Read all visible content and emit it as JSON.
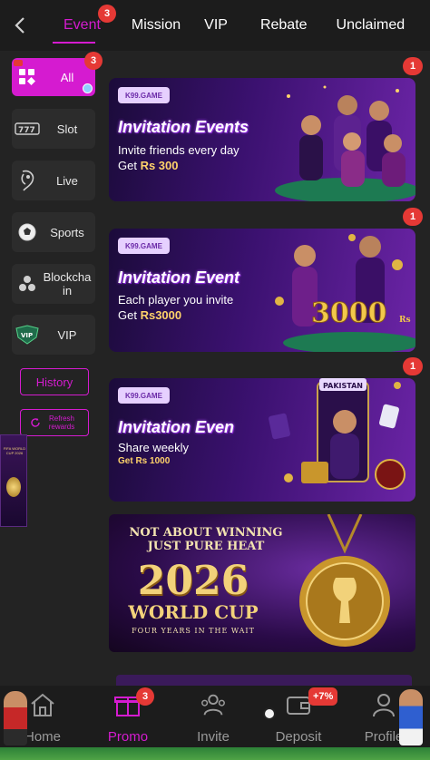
{
  "header": {
    "tabs": [
      {
        "label": "Event",
        "badge": "3"
      },
      {
        "label": "Mission"
      },
      {
        "label": "VIP"
      },
      {
        "label": "Rebate"
      },
      {
        "label": "Unclaimed"
      }
    ]
  },
  "sidebar": {
    "items": [
      {
        "label": "All",
        "badge": "3",
        "icon": "grid-icon"
      },
      {
        "label": "Slot",
        "icon": "slot-icon"
      },
      {
        "label": "Live",
        "icon": "live-icon"
      },
      {
        "label": "Sports",
        "icon": "soccer-ball-icon"
      },
      {
        "label": "Blockchain",
        "icon": "blockchain-icon"
      },
      {
        "label": "VIP",
        "icon": "vip-icon"
      }
    ],
    "history_label": "History",
    "refresh_label": "Refresh rewards"
  },
  "banners": [
    {
      "brand": "K99.GAME",
      "title": "Invitation Events",
      "line1": "Invite friends every day",
      "line2_prefix": "Get ",
      "line2_value": "Rs 300",
      "notif": "1"
    },
    {
      "brand": "K99.GAME",
      "title": "Invitation Event",
      "line1": "Each player you invite",
      "line2_prefix": "Get ",
      "line2_value": "Rs3000",
      "art_text": "3000",
      "art_unit": "Rs",
      "notif": "1"
    },
    {
      "brand": "K99.GAME",
      "title": "Invitation Even",
      "line1": "Share weekly",
      "line2_prefix": "",
      "line2_value": "Get Rs 1000",
      "art_text": "PAKISTAN",
      "notif": "1"
    }
  ],
  "world_cup": {
    "line1": "NOT ABOUT WINNING JUST PURE HEAT",
    "year": "2026",
    "name": "WORLD CUP",
    "tagline": "FOUR YEARS IN THE WAIT"
  },
  "float_ad": {
    "text": "FIFA WORLD CUP 2026"
  },
  "bottom_nav": {
    "items": [
      {
        "label": "Home"
      },
      {
        "label": "Promo",
        "badge": "3"
      },
      {
        "label": "Invite"
      },
      {
        "label": "Deposit",
        "badge": "+7%"
      },
      {
        "label": "Profile"
      }
    ]
  },
  "colors": {
    "accent": "#d51bd0",
    "background": "#232323",
    "badge": "#e53935"
  }
}
